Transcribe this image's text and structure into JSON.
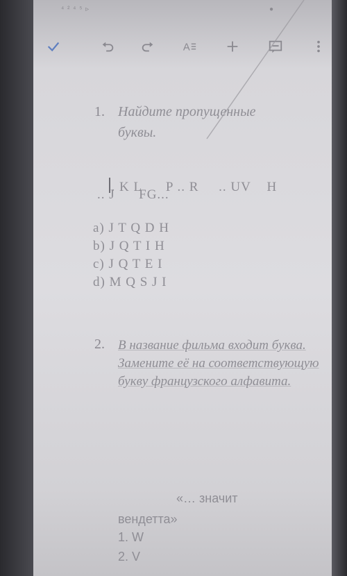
{
  "statusbar": {
    "left": "⁴ ² ⁴ ⁵ ▹",
    "right": "●"
  },
  "toolbar": {
    "done": "check-icon",
    "undo": "undo-icon",
    "redo": "redo-icon",
    "format": "text-format-icon",
    "insert": "plus-icon",
    "comment": "comment-icon",
    "more": "more-vertical-icon"
  },
  "question1": {
    "number": "1.",
    "line1": "Найдите пропущенные",
    "line2": "буквы.",
    "sequence_line1": ". K L      P .. R     .. UV    H",
    "sequence_line2": ".. J      FG...",
    "options": [
      "a) J T Q D H",
      "b) J Q T I H",
      "c) J Q T E I",
      "d) M Q S J I"
    ]
  },
  "question2": {
    "number": "2.",
    "text": "В название фильма входит буква. Замените её на соответствующую букву французского алфавита.",
    "quote_line1": "«… значит",
    "quote_line2": "вендетта»",
    "answers": [
      "1. W",
      "2. V"
    ]
  }
}
